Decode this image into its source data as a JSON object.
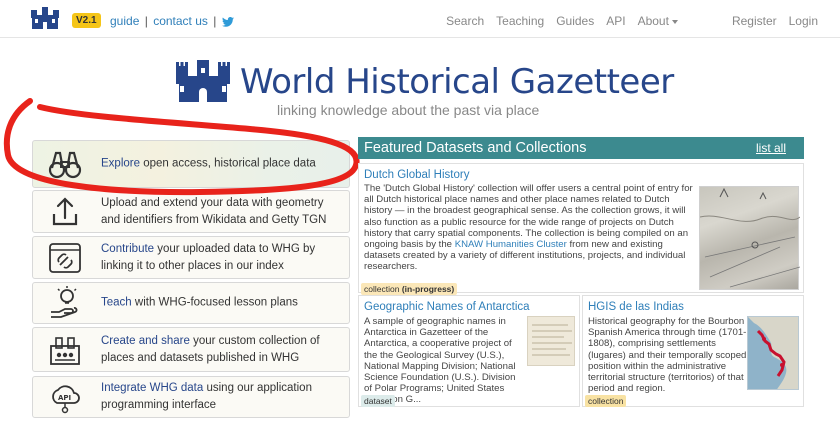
{
  "navbar": {
    "version": "V2.1",
    "guide": "guide",
    "separator": "|",
    "contact": "contact us",
    "twitter_icon": "twitter-icon",
    "links": [
      "Search",
      "Teaching",
      "Guides",
      "API"
    ],
    "about": "About",
    "register": "Register",
    "login": "Login"
  },
  "hero": {
    "title": "World Historical Gazetteer",
    "subtitle": "linking knowledge about the past via place",
    "logo_icon": "castle-logo-icon"
  },
  "cards": {
    "explore": {
      "icon": "binoculars-icon",
      "highlight": "Explore",
      "text": " open access, historical place data"
    },
    "upload": {
      "icon": "upload-icon",
      "text": "Upload and extend your data with geometry and identifiers from Wikidata and Getty TGN"
    },
    "contribute": {
      "icon": "link-icon",
      "highlight": "Contribute",
      "text": " your uploaded data to WHG by linking it to other places in our index"
    },
    "teach": {
      "icon": "lightbulb-hand-icon",
      "highlight": "Teach",
      "text": " with WHG-focused lesson plans"
    },
    "create": {
      "icon": "collection-icon",
      "highlight": "Create and share",
      "text": " your custom collection of places and datasets published in WHG"
    },
    "integrate": {
      "icon": "api-icon",
      "highlight": "Integrate WHG data",
      "text": " using our application programming interface"
    }
  },
  "featured": {
    "title": "Featured Datasets and Collections",
    "list_all": "list all",
    "datasets": {
      "dutch": {
        "title": "Dutch Global History",
        "desc_before": "The 'Dutch Global History' collection will offer users a central point of entry for all Dutch historical place names and other place names related to Dutch history — in the broadest geographical sense. As the collection grows, it will also function as a public resource for the wide range of projects on Dutch history that carry spatial components. The collection is being compiled on an ongoing basis by the ",
        "desc_link": "KNAW Humanities Cluster",
        "desc_after": " from new and existing datasets created by a variety of different institutions, projects, and individual researchers.",
        "badge_type": "collection",
        "badge_status": "(in-progress)"
      },
      "antarctica": {
        "title": "Geographic Names of Antarctica",
        "desc": "A sample of geographic names in Antarctica in Gazetteer of the Antarctica, a cooperative project of the the Geological Survey (U.S.), National Mapping Division; National Science Foundation (U.S.). Division of Polar Programs; United States Board on G...",
        "badge": "dataset"
      },
      "hgis": {
        "title": "HGIS de las Indias",
        "desc": "Historical geography for the Bourbon Spanish America through time (1701-1808), comprising settlements (lugares) and their temporally scoped position within the administrative territorial structure (territorios) of that period and region.",
        "badge": "collection"
      }
    }
  },
  "colors": {
    "brand_blue": "#27468a",
    "link_blue": "#2f7fb9",
    "teal_header": "#3c8a8f",
    "version_badge": "#f5c518",
    "annotation_red": "#e8231b"
  }
}
